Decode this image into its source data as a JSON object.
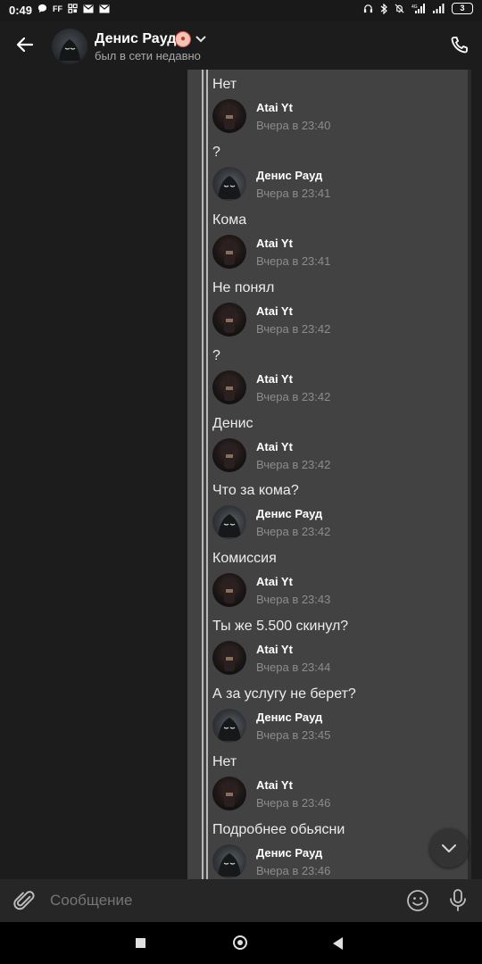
{
  "status_bar": {
    "time": "0:49",
    "left_icons": [
      "chat-bubble-icon",
      "ff-icon",
      "app-grid-icon",
      "mail-icon",
      "mail-icon"
    ],
    "battery": "3"
  },
  "header": {
    "name": "Денис Рауд",
    "emoji": "clown-emoji",
    "status": "был в сети недавно"
  },
  "messages": [
    {
      "text": "Нет",
      "author": "Atai Yt",
      "time": "Вчера в 23:40",
      "avatar": "atai"
    },
    {
      "text": "?",
      "author": "Денис Рауд",
      "time": "Вчера в 23:41",
      "avatar": "denis"
    },
    {
      "text": "Кома",
      "author": "Atai Yt",
      "time": "Вчера в 23:41",
      "avatar": "atai"
    },
    {
      "text": "Не понял",
      "author": "Atai Yt",
      "time": "Вчера в 23:42",
      "avatar": "atai"
    },
    {
      "text": "?",
      "author": "Atai Yt",
      "time": "Вчера в 23:42",
      "avatar": "atai"
    },
    {
      "text": "Денис",
      "author": "Atai Yt",
      "time": "Вчера в 23:42",
      "avatar": "atai"
    },
    {
      "text": "Что за кома?",
      "author": "Денис Рауд",
      "time": "Вчера в 23:42",
      "avatar": "denis"
    },
    {
      "text": "Комиссия",
      "author": "Atai Yt",
      "time": "Вчера в 23:43",
      "avatar": "atai"
    },
    {
      "text": "Ты же 5.500 скинул?",
      "author": "Atai Yt",
      "time": "Вчера в 23:44",
      "avatar": "atai"
    },
    {
      "text": "А за услугу не берет?",
      "author": "Денис Рауд",
      "time": "Вчера в 23:45",
      "avatar": "denis"
    },
    {
      "text": "Нет",
      "author": "Atai Yt",
      "time": "Вчера в 23:46",
      "avatar": "atai"
    },
    {
      "text": "Подробнее обьясни",
      "author": "Денис Рауд",
      "time": "Вчера в 23:46",
      "avatar": "denis"
    }
  ],
  "composer": {
    "placeholder": "Сообщение"
  },
  "colors": {
    "background": "#1c1c1c",
    "forward_panel": "#424242",
    "accent_text": "#ffffff",
    "muted_text": "#8c8c8c"
  }
}
